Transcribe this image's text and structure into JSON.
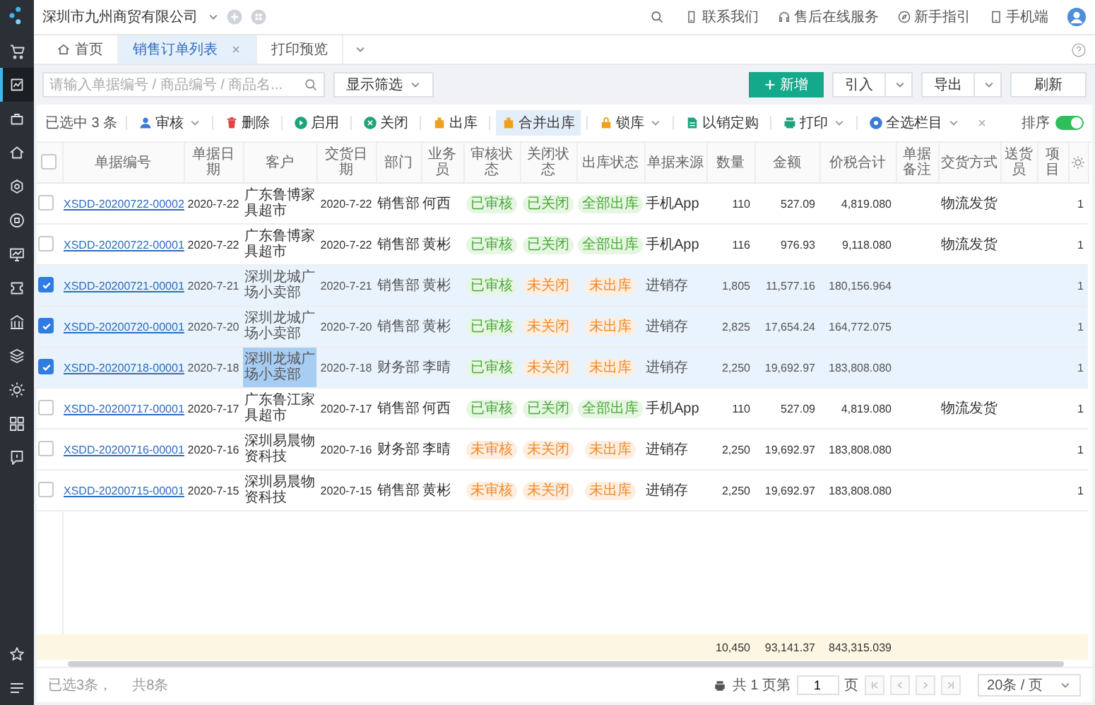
{
  "sidebar": {
    "items": [
      {
        "selected": false
      },
      {
        "selected": true
      },
      {
        "selected": false
      },
      {
        "selected": false
      },
      {
        "selected": false
      },
      {
        "selected": false
      },
      {
        "selected": false
      },
      {
        "selected": false
      },
      {
        "selected": false
      },
      {
        "selected": false
      },
      {
        "selected": false
      },
      {
        "selected": false
      },
      {
        "selected": false
      }
    ],
    "bottom": [
      {
        "selected": false
      },
      {
        "selected": false
      }
    ]
  },
  "topbar": {
    "company": "深圳市九州商贸有限公司",
    "links": [
      "联系我们",
      "售后在线服务",
      "新手指引",
      "手机端"
    ]
  },
  "tabs": [
    {
      "label": "首页",
      "selected": false,
      "closable": false
    },
    {
      "label": "销售订单列表",
      "selected": true,
      "closable": true
    },
    {
      "label": "打印预览",
      "selected": false,
      "closable": false
    }
  ],
  "filter": {
    "placeholder": "请输入单据编号 / 商品编号 / 商品名...",
    "button": "显示筛选"
  },
  "actions": [
    {
      "label": "新增",
      "kind": "primary"
    },
    {
      "label": "引入",
      "kind": "split"
    },
    {
      "label": "导出",
      "kind": "split"
    },
    {
      "label": "刷新",
      "kind": "plain"
    }
  ],
  "toolbar": {
    "selection": "已选中 3 条",
    "sort_label": "排序",
    "sort_on": true,
    "actions": [
      {
        "label": "审核",
        "dropdown": true,
        "hovered": false
      },
      {
        "label": "删除",
        "dropdown": false,
        "hovered": false
      },
      {
        "label": "启用",
        "dropdown": false,
        "hovered": false
      },
      {
        "label": "关闭",
        "dropdown": false,
        "hovered": false
      },
      {
        "label": "出库",
        "dropdown": false,
        "hovered": false
      },
      {
        "label": "合并出库",
        "dropdown": false,
        "hovered": true
      },
      {
        "label": "锁库",
        "dropdown": true,
        "hovered": false
      },
      {
        "label": "以销定购",
        "dropdown": false,
        "hovered": false
      },
      {
        "label": "打印",
        "dropdown": true,
        "hovered": false
      },
      {
        "label": "全选栏目",
        "dropdown": true,
        "hovered": false
      }
    ]
  },
  "table": {
    "all_selected": false,
    "columns": [
      "单据编号",
      "单据日期",
      "客户",
      "交货日期",
      "部门",
      "业务员",
      "审核状态",
      "关闭状态",
      "出库状态",
      "单据来源",
      "数量",
      "金额",
      "价税合计",
      "单据备注",
      "交货方式",
      "送货员",
      "项目"
    ],
    "rows": [
      {
        "selected": false,
        "customer_selected": false,
        "number": "XSDD-20200722-00002",
        "date": "2020-7-22",
        "customer": "广东鲁博家具超市",
        "delivery_date": "2020-7-22",
        "department": "销售部",
        "salesperson": "何西",
        "audit": {
          "text": "已审核",
          "kind": "done"
        },
        "close": {
          "text": "已关闭",
          "kind": "done"
        },
        "stock": {
          "text": "全部出库",
          "kind": "done"
        },
        "source": "手机App",
        "quantity": "110",
        "amount": "527.09",
        "total": "4,819.080",
        "shipping": "物流发货",
        "column_18": "1"
      },
      {
        "selected": false,
        "customer_selected": false,
        "number": "XSDD-20200722-00001",
        "date": "2020-7-22",
        "customer": "广东鲁博家具超市",
        "delivery_date": "2020-7-22",
        "department": "销售部",
        "salesperson": "黄彬",
        "audit": {
          "text": "已审核",
          "kind": "done"
        },
        "close": {
          "text": "已关闭",
          "kind": "done"
        },
        "stock": {
          "text": "全部出库",
          "kind": "done"
        },
        "source": "手机App",
        "quantity": "116",
        "amount": "976.93",
        "total": "9,118.080",
        "shipping": "物流发货",
        "column_18": "1"
      },
      {
        "selected": true,
        "customer_selected": false,
        "number": "XSDD-20200721-00001",
        "date": "2020-7-21",
        "customer": "深圳龙城广场小卖部",
        "delivery_date": "2020-7-21",
        "department": "销售部",
        "salesperson": "黄彬",
        "audit": {
          "text": "已审核",
          "kind": "done"
        },
        "close": {
          "text": "未关闭",
          "kind": "pending"
        },
        "stock": {
          "text": "未出库",
          "kind": "pending"
        },
        "source": "进销存",
        "quantity": "1,805",
        "amount": "11,577.16",
        "total": "180,156.964",
        "column_18": "1"
      },
      {
        "selected": true,
        "customer_selected": false,
        "number": "XSDD-20200720-00001",
        "date": "2020-7-20",
        "customer": "深圳龙城广场小卖部",
        "delivery_date": "2020-7-20",
        "department": "销售部",
        "salesperson": "黄彬",
        "audit": {
          "text": "已审核",
          "kind": "done"
        },
        "close": {
          "text": "未关闭",
          "kind": "pending"
        },
        "stock": {
          "text": "未出库",
          "kind": "pending"
        },
        "source": "进销存",
        "quantity": "2,825",
        "amount": "17,654.24",
        "total": "164,772.075",
        "column_18": "1"
      },
      {
        "selected": true,
        "customer_selected": true,
        "number": "XSDD-20200718-00001",
        "date": "2020-7-18",
        "customer": "深圳龙城广场小卖部",
        "delivery_date": "2020-7-18",
        "department": "财务部",
        "salesperson": "李晴",
        "audit": {
          "text": "已审核",
          "kind": "done"
        },
        "close": {
          "text": "未关闭",
          "kind": "pending"
        },
        "stock": {
          "text": "未出库",
          "kind": "pending"
        },
        "source": "进销存",
        "quantity": "2,250",
        "amount": "19,692.97",
        "total": "183,808.080",
        "column_18": "1"
      },
      {
        "selected": false,
        "customer_selected": false,
        "number": "XSDD-20200717-00001",
        "date": "2020-7-17",
        "customer": "广东鲁江家具超市",
        "delivery_date": "2020-7-17",
        "department": "销售部",
        "salesperson": "何西",
        "audit": {
          "text": "已审核",
          "kind": "done"
        },
        "close": {
          "text": "已关闭",
          "kind": "done"
        },
        "stock": {
          "text": "全部出库",
          "kind": "done"
        },
        "source": "手机App",
        "quantity": "110",
        "amount": "527.09",
        "total": "4,819.080",
        "shipping": "物流发货",
        "column_18": "1"
      },
      {
        "selected": false,
        "customer_selected": false,
        "number": "XSDD-20200716-00001",
        "date": "2020-7-16",
        "customer": "深圳易晨物资科技",
        "delivery_date": "2020-7-16",
        "department": "财务部",
        "salesperson": "李晴",
        "audit": {
          "text": "未审核",
          "kind": "pending"
        },
        "close": {
          "text": "未关闭",
          "kind": "pending"
        },
        "stock": {
          "text": "未出库",
          "kind": "pending"
        },
        "source": "进销存",
        "quantity": "2,250",
        "amount": "19,692.97",
        "total": "183,808.080",
        "column_18": "1"
      },
      {
        "selected": false,
        "customer_selected": false,
        "number": "XSDD-20200715-00001",
        "date": "2020-7-15",
        "customer": "深圳易晨物资科技",
        "delivery_date": "2020-7-15",
        "department": "销售部",
        "salesperson": "黄彬",
        "audit": {
          "text": "未审核",
          "kind": "pending"
        },
        "close": {
          "text": "未关闭",
          "kind": "pending"
        },
        "stock": {
          "text": "未出库",
          "kind": "pending"
        },
        "source": "进销存",
        "quantity": "2,250",
        "amount": "19,692.97",
        "total": "183,808.080",
        "column_18": "1"
      }
    ],
    "totals": {
      "quantity": "10,450",
      "amount": "93,141.37",
      "total": "843,315.039"
    }
  },
  "footer": {
    "selected_count": "已选3条，",
    "total_count": "共8条",
    "pages_before": "共 1 页第",
    "page": "1",
    "pages_after": "页",
    "page_size": "20条 / 页"
  }
}
